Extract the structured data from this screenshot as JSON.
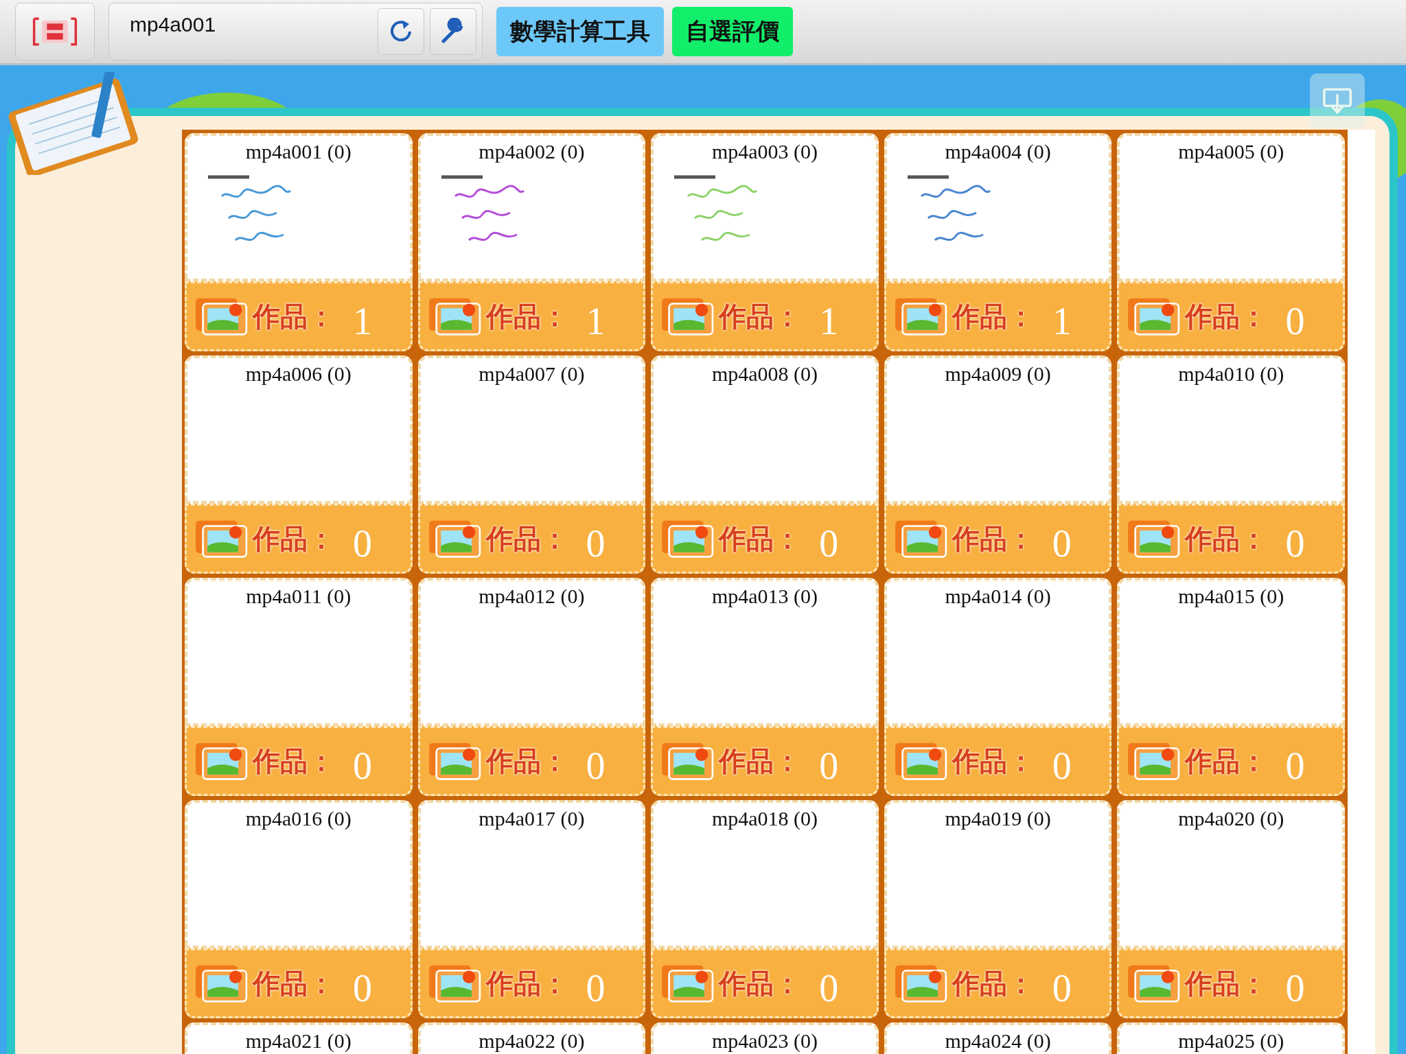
{
  "toolbar": {
    "address": "mp4a001",
    "buttons": [
      {
        "label": "數學計算工具",
        "color": "#6cc8f8"
      },
      {
        "label": "自選評價",
        "color": "#13ee6a"
      }
    ]
  },
  "cards": [
    {
      "title": "mp4a001 (0)",
      "label": "作品：",
      "count": "1"
    },
    {
      "title": "mp4a002 (0)",
      "label": "作品：",
      "count": "1"
    },
    {
      "title": "mp4a003 (0)",
      "label": "作品：",
      "count": "1"
    },
    {
      "title": "mp4a004 (0)",
      "label": "作品：",
      "count": "1"
    },
    {
      "title": "mp4a005 (0)",
      "label": "作品：",
      "count": "0"
    },
    {
      "title": "mp4a006 (0)",
      "label": "作品：",
      "count": "0"
    },
    {
      "title": "mp4a007 (0)",
      "label": "作品：",
      "count": "0"
    },
    {
      "title": "mp4a008 (0)",
      "label": "作品：",
      "count": "0"
    },
    {
      "title": "mp4a009 (0)",
      "label": "作品：",
      "count": "0"
    },
    {
      "title": "mp4a010 (0)",
      "label": "作品：",
      "count": "0"
    },
    {
      "title": "mp4a011 (0)",
      "label": "作品：",
      "count": "0"
    },
    {
      "title": "mp4a012 (0)",
      "label": "作品：",
      "count": "0"
    },
    {
      "title": "mp4a013 (0)",
      "label": "作品：",
      "count": "0"
    },
    {
      "title": "mp4a014 (0)",
      "label": "作品：",
      "count": "0"
    },
    {
      "title": "mp4a015 (0)",
      "label": "作品：",
      "count": "0"
    },
    {
      "title": "mp4a016 (0)",
      "label": "作品：",
      "count": "0"
    },
    {
      "title": "mp4a017 (0)",
      "label": "作品：",
      "count": "0"
    },
    {
      "title": "mp4a018 (0)",
      "label": "作品：",
      "count": "0"
    },
    {
      "title": "mp4a019 (0)",
      "label": "作品：",
      "count": "0"
    },
    {
      "title": "mp4a020 (0)",
      "label": "作品：",
      "count": "0"
    },
    {
      "title": "mp4a021 (0)"
    },
    {
      "title": "mp4a022 (0)"
    },
    {
      "title": "mp4a023 (0)"
    },
    {
      "title": "mp4a024 (0)"
    },
    {
      "title": "mp4a025 (0)"
    }
  ]
}
